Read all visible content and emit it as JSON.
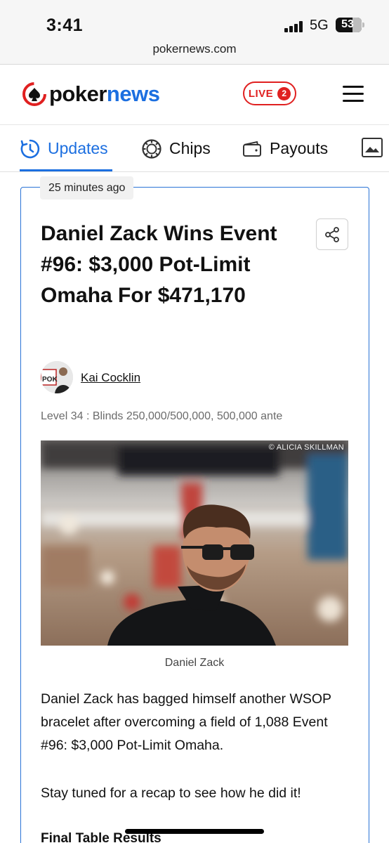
{
  "status_bar": {
    "time": "3:41",
    "network": "5G",
    "battery": "53"
  },
  "browser": {
    "url": "pokernews.com"
  },
  "header": {
    "logo_part1": "poker",
    "logo_part2": "news",
    "live_label": "LIVE",
    "live_count": "2"
  },
  "tabs": [
    {
      "label": "Updates",
      "icon": "clock-refresh-icon",
      "active": true
    },
    {
      "label": "Chips",
      "icon": "poker-chip-icon",
      "active": false
    },
    {
      "label": "Payouts",
      "icon": "wallet-icon",
      "active": false
    },
    {
      "label": "",
      "icon": "image-gallery-icon",
      "active": false
    }
  ],
  "post": {
    "time_ago": "25 minutes ago",
    "headline": "Daniel Zack Wins Event #96: $3,000 Pot-Limit Omaha For $471,170",
    "author": "Kai Cocklin",
    "level": "Level 34 : Blinds 250,000/500,000, 500,000 ante",
    "photo_credit": "© ALICIA SKILLMAN",
    "caption": "Daniel Zack",
    "paragraph1": "Daniel Zack has bagged himself another WSOP bracelet after overcoming a field of 1,088 Event #96: $3,000 Pot-Limit Omaha.",
    "paragraph2": "Stay tuned for a recap to see how he did it!",
    "subheading": "Final Table Results"
  },
  "colors": {
    "accent": "#1c6fe0",
    "live_red": "#e02020",
    "card_border": "#2a73d6"
  }
}
